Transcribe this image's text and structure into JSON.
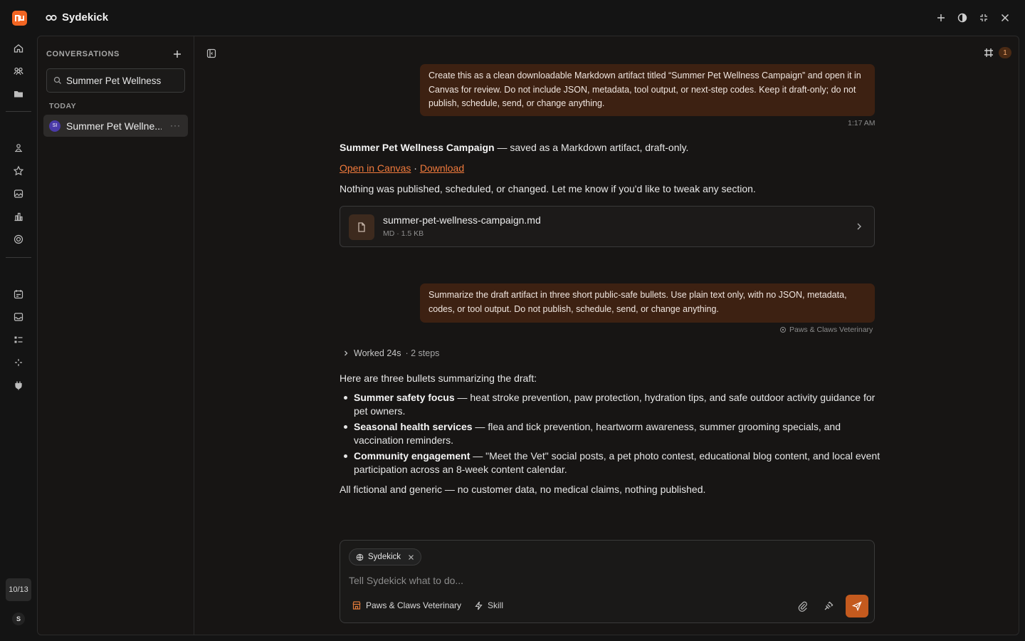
{
  "app": {
    "title": "Sydekick"
  },
  "rail": {
    "counter": "10/13",
    "user_initial": "S"
  },
  "sidebar": {
    "heading": "CONVERSATIONS",
    "search_value": "Summer Pet Wellness",
    "group_label": "TODAY",
    "conversation": {
      "avatar": "SI",
      "title": "Summer Pet Wellne...",
      "more": "···"
    }
  },
  "canvas": {
    "count": "1"
  },
  "messages": {
    "user1": {
      "text": "Create this as a clean downloadable Markdown artifact titled “Summer Pet Wellness Campaign” and open it in Canvas for review. Do not include JSON, metadata, tool output, or next-step codes. Keep it draft-only; do not publish, schedule, send, or change anything.",
      "time": "1:17 AM"
    },
    "assistant1": {
      "title": "Summer Pet Wellness Campaign",
      "title_suffix": " — saved as a Markdown artifact, draft-only.",
      "open_link": "Open in Canvas",
      "separator": " · ",
      "download_link": "Download",
      "note": "Nothing was published, scheduled, or changed. Let me know if you'd like to tweak any section."
    },
    "file": {
      "name": "summer-pet-wellness-campaign.md",
      "meta": "MD · 1.5 KB"
    },
    "user2": {
      "text": "Summarize the draft artifact in three short public-safe bullets. Use plain text only, with no JSON, metadata, codes, or tool output. Do not publish, schedule, send, or change anything.",
      "workspace": "Paws & Claws Veterinary"
    },
    "worked": {
      "label": "Worked 24s",
      "steps": "· 2 steps"
    },
    "assistant2": {
      "intro": "Here are three bullets summarizing the draft:",
      "bullets": [
        {
          "title": "Summer safety focus",
          "text": " — heat stroke prevention, paw protection, hydration tips, and safe outdoor activity guidance for pet owners."
        },
        {
          "title": "Seasonal health services",
          "text": " — flea and tick prevention, heartworm awareness, summer grooming specials, and vaccination reminders."
        },
        {
          "title": "Community engagement",
          "text": " — \"Meet the Vet\" social posts, a pet photo contest, educational blog content, and local event participation across an 8-week content calendar."
        }
      ],
      "closing": "All fictional and generic — no customer data, no medical claims, nothing published."
    }
  },
  "composer": {
    "agent_chip": "Sydekick",
    "placeholder": "Tell Sydekick what to do...",
    "workspace": "Paws & Claws Veterinary",
    "skill": "Skill"
  },
  "colors": {
    "accent": "#f26522",
    "bubble": "#3d2112",
    "link": "#f07a3c"
  }
}
